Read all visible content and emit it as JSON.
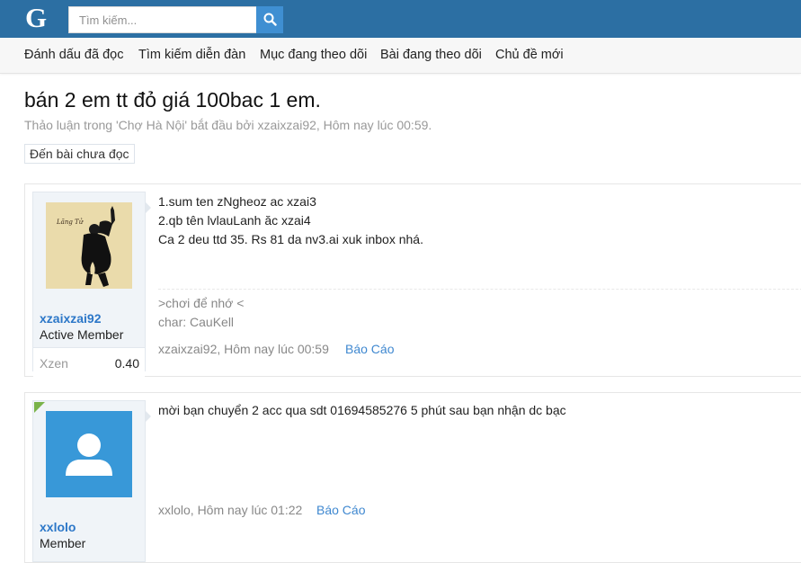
{
  "header": {
    "logo_letter": "G",
    "search_placeholder": "Tìm kiếm..."
  },
  "nav": {
    "items": [
      "Đánh dấu đã đọc",
      "Tìm kiếm diễn đàn",
      "Mục đang theo dõi",
      "Bài đang theo dõi",
      "Chủ đề mới"
    ]
  },
  "thread": {
    "title": "bán 2 em tt đỏ giá 100bac 1 em.",
    "subtitle": "Thảo luận trong 'Chợ Hà Nội' bắt đầu bởi xzaixzai92, Hôm nay lúc 00:59.",
    "unread_button": "Đến bài chưa đọc"
  },
  "posts": [
    {
      "avatar_text": "Lãng Tử",
      "username": "xzaixzai92",
      "user_title": "Active Member",
      "stat_label": "Xzen",
      "stat_value": "0.40",
      "message_lines": [
        "1.sum ten zNgheoz ac xzai3",
        "2.qb tên lvlauLanh ăc xzai4",
        "Ca 2 deu ttd 35. Rs 81 da nv3.ai xuk inbox nhá."
      ],
      "signature_lines": [
        ">chơi để nhớ <",
        "char: CauKell"
      ],
      "meta": "xzaixzai92, Hôm nay lúc 00:59",
      "report_label": "Báo Cáo"
    },
    {
      "username": "xxlolo",
      "user_title": "Member",
      "message_lines": [
        "mời bạn chuyển 2 acc qua sdt 01694585276 5 phút sau bạn nhận dc bạc"
      ],
      "meta": "xxlolo, Hôm nay lúc 01:22",
      "report_label": "Báo Cáo"
    }
  ],
  "colors": {
    "topbar": "#2c6fa3",
    "search_button": "#3f8fd2",
    "link_blue": "#2c77c8",
    "default_avatar": "#3898d8"
  },
  "icons": {
    "search": "search-icon",
    "default_avatar": "user-silhouette-icon"
  }
}
